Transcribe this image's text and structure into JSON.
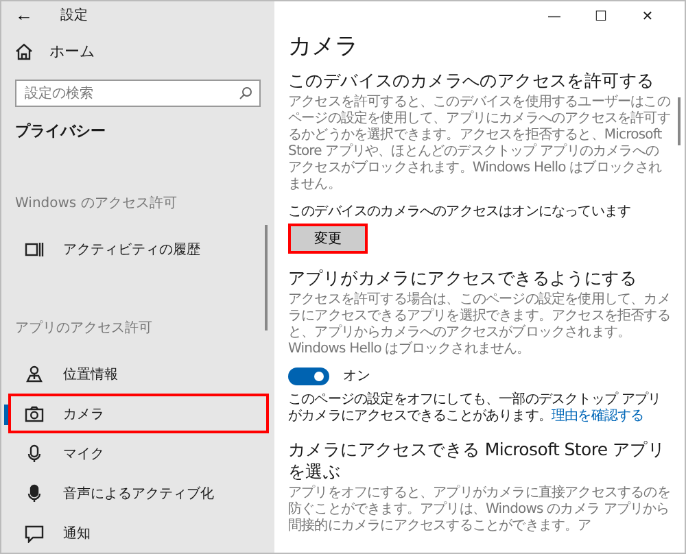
{
  "window": {
    "title": "設定",
    "back": "←",
    "controls": [
      "—",
      "☐",
      "✕"
    ]
  },
  "sidebar": {
    "home": "ホーム",
    "search": {
      "placeholder": "設定の検索"
    },
    "section_title": "プライバシー",
    "groups": [
      {
        "heading": "Windows のアクセス許可",
        "items": [
          {
            "label": "アクティビティの履歴",
            "selected": false,
            "highlighted": false
          }
        ]
      },
      {
        "heading": "アプリのアクセス許可",
        "items": [
          {
            "label": "位置情報",
            "selected": false,
            "highlighted": false
          },
          {
            "label": "カメラ",
            "selected": true,
            "highlighted": true
          },
          {
            "label": "マイク",
            "selected": false,
            "highlighted": false
          },
          {
            "label": "音声によるアクティブ化",
            "selected": false,
            "highlighted": false
          },
          {
            "label": "通知",
            "selected": false,
            "highlighted": false
          }
        ]
      }
    ]
  },
  "main": {
    "title": "カメラ",
    "sections": [
      {
        "heading": "このデバイスのカメラへのアクセスを許可する",
        "description": "アクセスを許可すると、このデバイスを使用するユーザーはこのページの設定を使用して、アプリにカメラへのアクセスを許可するかどうかを選択できます。アクセスを拒否すると、Microsoft Store アプリや、ほとんどのデスクトップ アプリのカメラへのアクセスがブロックされます。Windows Hello はブロックされません。",
        "status": "このデバイスのカメラへのアクセスはオンになっています",
        "button": {
          "label": "変更",
          "highlighted": true
        }
      },
      {
        "heading": "アプリがカメラにアクセスできるようにする",
        "description": "アクセスを許可する場合は、このページの設定を使用して、カメラにアクセスできるアプリを選択できます。アクセスを拒否すると、アプリからカメラへのアクセスがブロックされます。Windows Hello はブロックされません。",
        "toggle": {
          "on": true,
          "label": "オン"
        },
        "note": "このページの設定をオフにしても、一部のデスクトップ アプリがカメラにアクセスできることがあります。",
        "link": "理由を確認する"
      },
      {
        "heading": "カメラにアクセスできる Microsoft Store アプリを選ぶ",
        "description": "アプリをオフにすると、アプリがカメラに直接アクセスするのを防ぐことができます。アプリは、Windows のカメラ アプリから間接的にカメラにアクセスすることができます。ア"
      }
    ]
  }
}
